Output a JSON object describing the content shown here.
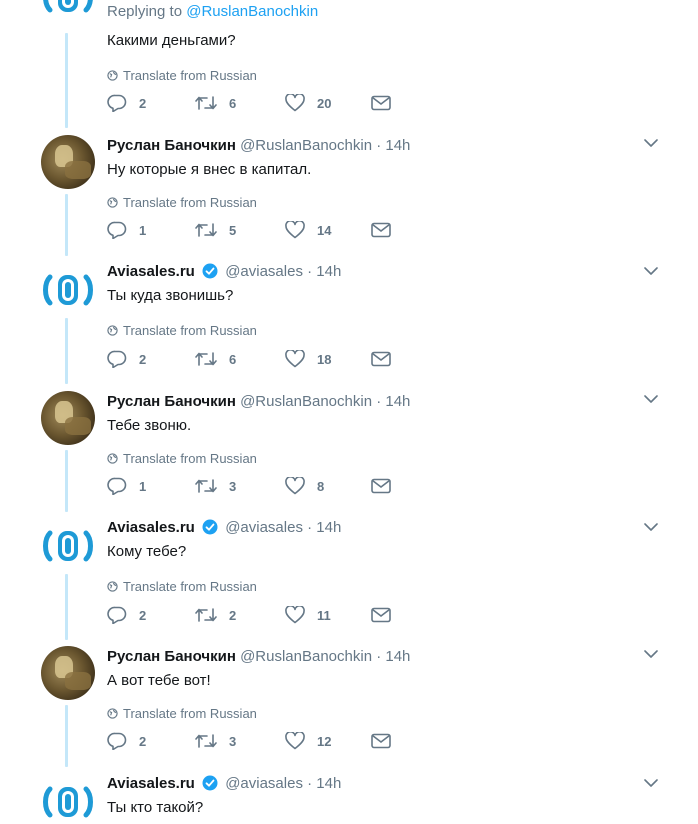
{
  "replying": {
    "prefix": "Replying to",
    "handle": "@RuslanBanochkin"
  },
  "translate_label": "Translate from Russian",
  "tweets": [
    {
      "kind": "aviasales",
      "name": "",
      "handle": "",
      "time": "",
      "text": "Какими деньгами?",
      "replies": "2",
      "retweets": "6",
      "likes": "20"
    },
    {
      "kind": "ruslan",
      "name": "Руслан Баночкин",
      "handle": "@RuslanBanochkin",
      "time": "14h",
      "text": "Ну которые я внес в капитал.",
      "replies": "1",
      "retweets": "5",
      "likes": "14"
    },
    {
      "kind": "aviasales",
      "name": "Aviasales.ru",
      "handle": "@aviasales",
      "time": "14h",
      "text": "Ты куда звонишь?",
      "replies": "2",
      "retweets": "6",
      "likes": "18"
    },
    {
      "kind": "ruslan",
      "name": "Руслан Баночкин",
      "handle": "@RuslanBanochkin",
      "time": "14h",
      "text": "Тебе звоню.",
      "replies": "1",
      "retweets": "3",
      "likes": "8"
    },
    {
      "kind": "aviasales",
      "name": "Aviasales.ru",
      "handle": "@aviasales",
      "time": "14h",
      "text": "Кому тебе?",
      "replies": "2",
      "retweets": "2",
      "likes": "11"
    },
    {
      "kind": "ruslan",
      "name": "Руслан Баночкин",
      "handle": "@RuslanBanochkin",
      "time": "14h",
      "text": "А вот тебе вот!",
      "replies": "2",
      "retweets": "3",
      "likes": "12"
    },
    {
      "kind": "aviasales",
      "name": "Aviasales.ru",
      "handle": "@aviasales",
      "time": "14h",
      "text": "Ты кто такой?",
      "replies": "",
      "retweets": "",
      "likes": ""
    }
  ],
  "icons": {
    "reply": "reply-icon",
    "retweet": "retweet-icon",
    "like": "heart-icon",
    "dm": "envelope-icon",
    "globe": "globe-icon",
    "more": "chevron-down-icon",
    "verified": "verified-badge-icon"
  },
  "colors": {
    "thread_line": "#c4e7f9",
    "link": "#1da1f2",
    "muted": "#657786",
    "brand": "#1e9ad6"
  }
}
